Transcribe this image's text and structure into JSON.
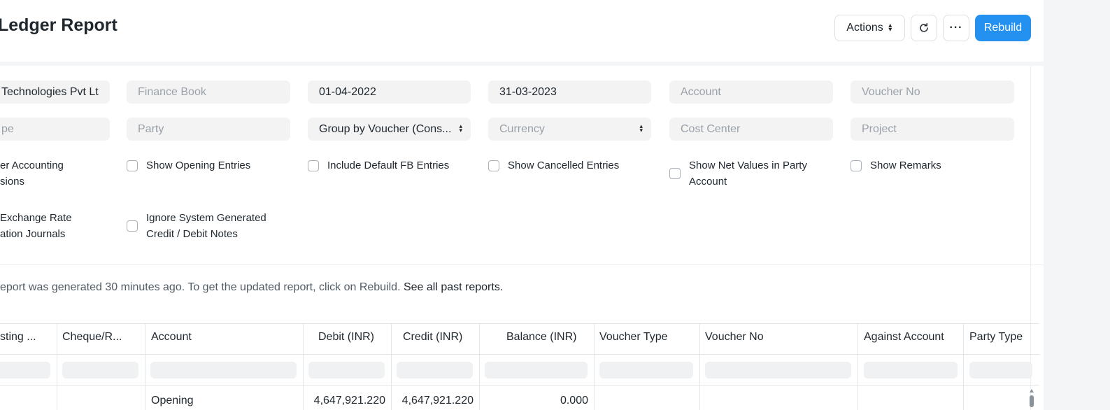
{
  "header": {
    "title": "Ledger Report",
    "actions_label": "Actions",
    "more_label": "···",
    "rebuild_label": "Rebuild"
  },
  "filters": {
    "company": "Technologies Pvt Lt",
    "finance_book_placeholder": "Finance Book",
    "from_date": "01-04-2022",
    "to_date": "31-03-2023",
    "account_placeholder": "Account",
    "voucher_no_placeholder": "Voucher No",
    "party_type_placeholder": "pe",
    "party_placeholder": "Party",
    "group_by": "Group by Voucher (Cons...",
    "currency_placeholder": "Currency",
    "cost_center_placeholder": "Cost Center",
    "project_placeholder": "Project"
  },
  "checkboxes": {
    "accounting_dimensions_line1": "er Accounting",
    "accounting_dimensions_line2": "sions",
    "show_opening_entries": "Show Opening Entries",
    "include_default_fb": "Include Default FB Entries",
    "show_cancelled": "Show Cancelled Entries",
    "net_values_line1": "Show Net Values in Party",
    "net_values_line2": "Account",
    "show_remarks": "Show Remarks",
    "exchange_rate_line1": "Exchange Rate",
    "exchange_rate_line2": "ation Journals",
    "ignore_system_line1": "Ignore System Generated",
    "ignore_system_line2": "Credit / Debit Notes"
  },
  "notice": {
    "text": "eport was generated 30 minutes ago. To get the updated report, click on Rebuild.",
    "link": "See all past reports."
  },
  "table": {
    "columns": [
      "sting ...",
      "Cheque/R...",
      "Account",
      "Debit (INR)",
      "Credit (INR)",
      "Balance (INR)",
      "Voucher Type",
      "Voucher No",
      "Against Account",
      "Party Type"
    ],
    "rows": [
      {
        "account": "Opening",
        "debit": "4,647,921.220",
        "credit": "4,647,921.220",
        "balance": "0.000"
      }
    ]
  }
}
